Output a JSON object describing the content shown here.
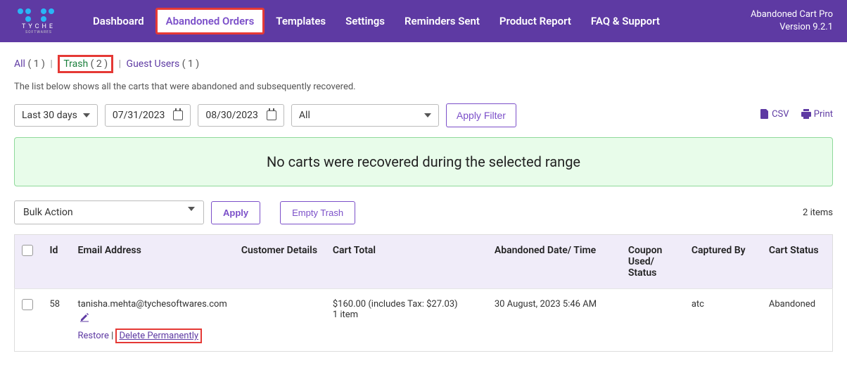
{
  "header": {
    "logo_text": "TYCHE",
    "logo_sub": "SOFTWARES",
    "nav": {
      "dashboard": "Dashboard",
      "abandoned": "Abandoned Orders",
      "templates": "Templates",
      "settings": "Settings",
      "reminders": "Reminders Sent",
      "product_report": "Product Report",
      "faq": "FAQ & Support"
    },
    "version_title": "Abandoned Cart Pro",
    "version_num": "Version 9.2.1"
  },
  "filters": {
    "all_label": "All",
    "all_count": "( 1 )",
    "trash_label": "Trash",
    "trash_count": "( 2 )",
    "guest_label": "Guest Users",
    "guest_count": "( 1 )"
  },
  "subtitle": "The list below shows all the carts that were abandoned and subsequently recovered.",
  "filter_row": {
    "range": "Last 30 days",
    "date_from": "07/31/2023",
    "date_to": "08/30/2023",
    "status_filter": "All",
    "apply": "Apply Filter"
  },
  "export": {
    "csv": "CSV",
    "print": "Print"
  },
  "alert": "No carts were recovered during the selected range",
  "bulk": {
    "select": "Bulk Action",
    "apply": "Apply",
    "empty": "Empty Trash",
    "count": "2 items"
  },
  "table": {
    "headers": {
      "id": "Id",
      "email": "Email Address",
      "customer": "Customer Details",
      "total": "Cart Total",
      "date": "Abandoned Date/ Time",
      "coupon": "Coupon Used/ Status",
      "captured": "Captured By",
      "status": "Cart Status"
    },
    "rows": [
      {
        "id": "58",
        "email": "tanisha.mehta@tychesoftwares.com",
        "total_line1": "$160.00 (includes Tax: $27.03)",
        "total_line2": "1 item",
        "date": "30 August, 2023 5:46 AM",
        "captured": "atc",
        "status": "Abandoned",
        "restore": "Restore",
        "delete": "Delete Permanently"
      }
    ]
  }
}
